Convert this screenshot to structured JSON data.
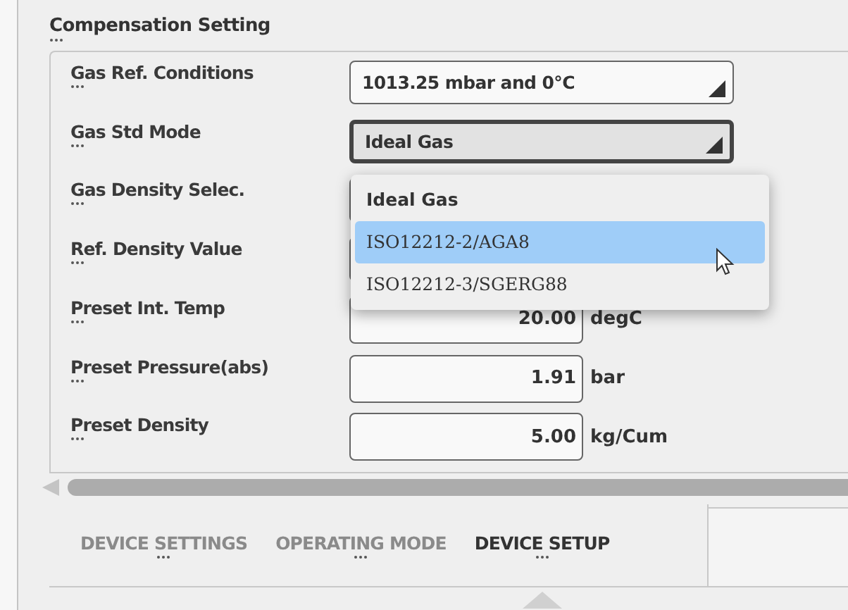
{
  "section_title": "Compensation Setting",
  "rows": [
    {
      "label": "Gas Ref. Conditions",
      "kind": "dropdown",
      "value": "1013.25 mbar and 0°C",
      "open": false
    },
    {
      "label": "Gas Std Mode",
      "kind": "dropdown",
      "value": "Ideal Gas",
      "open": true,
      "options": [
        {
          "label": "Ideal Gas",
          "selected": true,
          "highlighted": false
        },
        {
          "label": "ISO12212-2/AGA8",
          "selected": false,
          "highlighted": true
        },
        {
          "label": "ISO12212-3/SGERG88",
          "selected": false,
          "highlighted": false
        }
      ]
    },
    {
      "label": "Gas Density Selec.",
      "kind": "covered"
    },
    {
      "label": "Ref. Density Value",
      "kind": "covered"
    },
    {
      "label": "Preset Int. Temp",
      "kind": "number",
      "value": "20.00",
      "unit": "degC"
    },
    {
      "label": "Preset Pressure(abs)",
      "kind": "number",
      "value": "1.91",
      "unit": "bar"
    },
    {
      "label": "Preset Density",
      "kind": "number",
      "value": "5.00",
      "unit": "kg/Cum"
    }
  ],
  "tabs": [
    {
      "label": "DEVICE SETTINGS",
      "selected": false
    },
    {
      "label": "OPERATING MODE",
      "selected": false
    },
    {
      "label": "DEVICE SETUP",
      "selected": true
    }
  ]
}
